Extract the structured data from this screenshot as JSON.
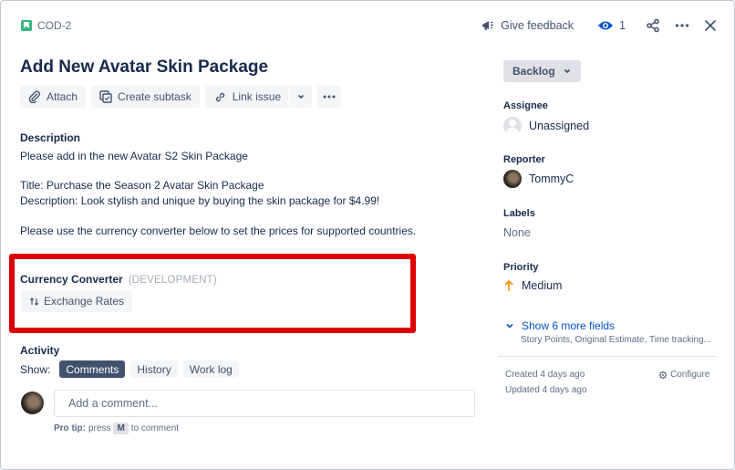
{
  "issue": {
    "key": "COD-2",
    "title": "Add New Avatar Skin Package"
  },
  "header_actions": {
    "feedback_label": "Give feedback",
    "watch_count": "1"
  },
  "toolbar": {
    "attach_label": "Attach",
    "create_subtask_label": "Create subtask",
    "link_issue_label": "Link issue"
  },
  "description": {
    "heading": "Description",
    "lines": [
      "Please add in the new Avatar S2 Skin Package",
      "Title: Purchase the Season 2 Avatar Skin Package",
      "Description: Look stylish and unique by buying the skin package for $4.99!",
      "Please use the currency converter below to set the prices for supported countries."
    ]
  },
  "currency_converter": {
    "heading": "Currency Converter",
    "tag": "(DEVELOPMENT)",
    "button_label": "Exchange Rates"
  },
  "activity": {
    "heading": "Activity",
    "show_label": "Show:",
    "tabs": [
      "Comments",
      "History",
      "Work log"
    ],
    "active_tab": "Comments",
    "comment_placeholder": "Add a comment...",
    "protip_prefix": "Pro tip:",
    "protip_press": "press",
    "protip_key": "M",
    "protip_suffix": "to comment"
  },
  "sidebar": {
    "status": "Backlog",
    "assignee_label": "Assignee",
    "assignee_value": "Unassigned",
    "reporter_label": "Reporter",
    "reporter_value": "TommyC",
    "labels_label": "Labels",
    "labels_value": "None",
    "priority_label": "Priority",
    "priority_value": "Medium",
    "more_fields_label": "Show 6 more fields",
    "more_fields_sub": "Story Points, Original Estimate, Time tracking...",
    "created": "Created 4 days ago",
    "updated": "Updated 4 days ago",
    "configure_label": "Configure"
  },
  "colors": {
    "highlight": "#dd0000",
    "priority_medium": "#ff8b00",
    "link": "#0052cc",
    "story": "#36b37e"
  }
}
